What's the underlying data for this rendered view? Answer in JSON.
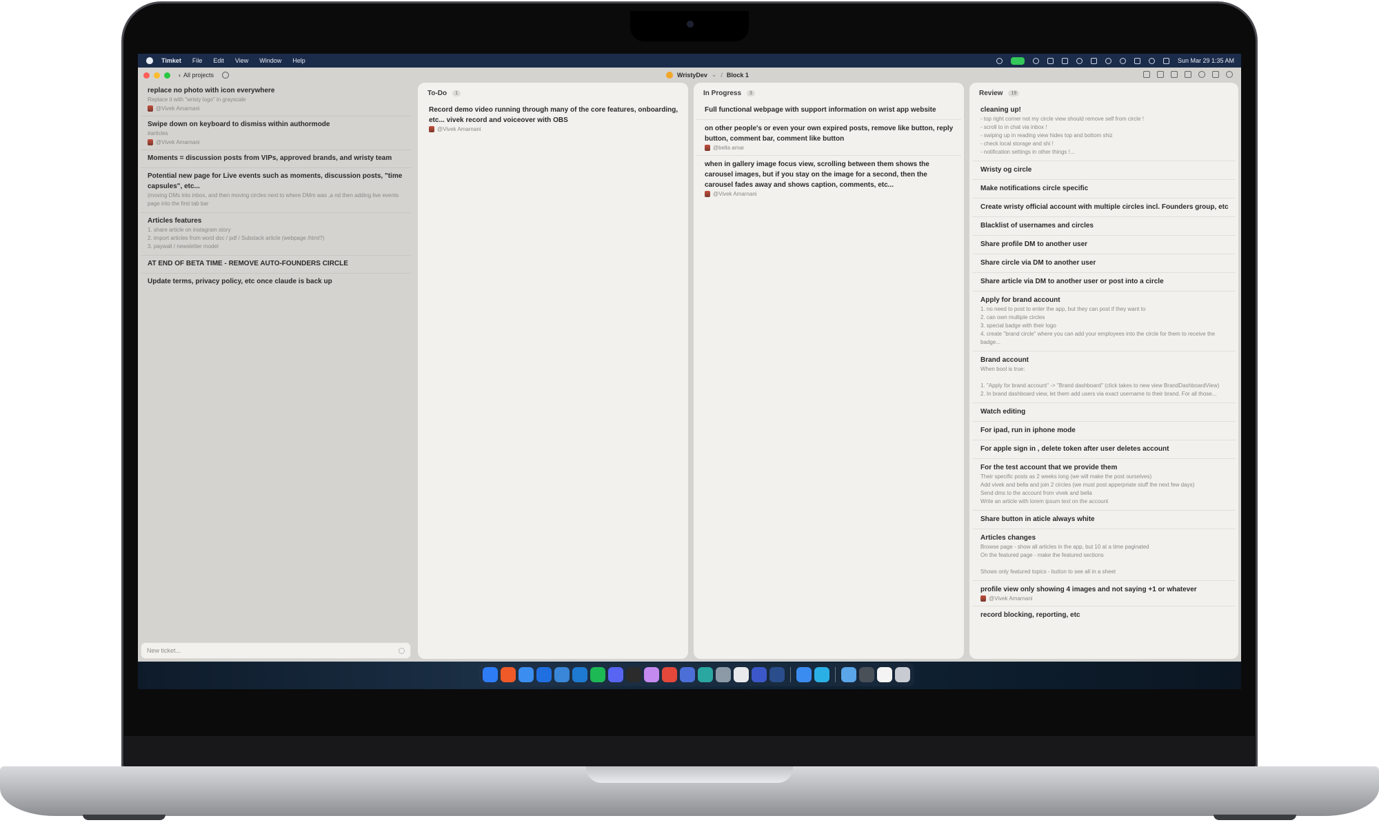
{
  "menubar": {
    "app_name": "Timket",
    "menus": [
      "File",
      "Edit",
      "View",
      "Window",
      "Help"
    ],
    "clock": "Sun Mar 29  1:35 AM"
  },
  "window": {
    "back_label": "All projects",
    "project": "WristyDev",
    "project_caret": "⌄",
    "separator": "/",
    "block": "Block 1"
  },
  "sidebar": {
    "items": [
      {
        "title": "replace no photo with icon everywhere",
        "desc": "Replace it with \"wristy logo\" in grayscale",
        "assignee": "@Vivek Amarnani"
      },
      {
        "title": "Swipe down on keyboard to dismiss within authormode",
        "desc": "#articles",
        "assignee": "@Vivek Amarnani"
      },
      {
        "title": "Moments = discussion posts from VIPs, approved brands, and wristy team",
        "desc": "",
        "assignee": ""
      },
      {
        "title": "Potential new page for Live events such as moments, discussion posts, \"time capsules\", etc...",
        "desc": "(moving DMs into inbox, and then moving circles next to where DMm was ,a nd then adding live events page into the first tab bar",
        "assignee": ""
      },
      {
        "title": "Articles features",
        "desc": "1. share article on instagram story\n2. import articles from word doc / pdf / Substack article (webpage /html?)\n3. paywall / newsletter model",
        "assignee": ""
      },
      {
        "title": "AT END OF BETA TIME - REMOVE AUTO-FOUNDERS CIRCLE",
        "desc": "",
        "assignee": ""
      },
      {
        "title": "Update terms, privacy policy, etc once claude is back up",
        "desc": "",
        "assignee": ""
      }
    ],
    "new_ticket_placeholder": "New ticket..."
  },
  "columns": {
    "todo": {
      "title": "To-Do",
      "count": "1",
      "cards": [
        {
          "title": "Record demo video running through many of the core features, onboarding, etc... vivek record and voiceover with OBS",
          "desc": "",
          "assignee": "@Vivek Amarnani"
        }
      ]
    },
    "progress": {
      "title": "In Progress",
      "count": "3",
      "cards": [
        {
          "title": "Full functional webpage with support information on wrist app website",
          "desc": "",
          "assignee": ""
        },
        {
          "title": "on other people's or even your own expired posts, remove like button, reply button, comment bar, comment like button",
          "desc": "",
          "assignee": "@bella amar"
        },
        {
          "title": "when in gallery image focus view, scrolling between them shows the carousel images, but if you  stay on the image for a second, then the carousel fades away and shows caption, comments, etc...",
          "desc": "",
          "assignee": "@Vivek Amarnani"
        }
      ]
    },
    "review": {
      "title": "Review",
      "count": "19",
      "cards": [
        {
          "title": "cleaning up!",
          "desc": "- top right corner not my circle view should remove self from circle !\n- scroll to in chat via inbox !\n- swiping up in reading view hides top and bottom shiz\n- check local storage and shi !\n- notification settings in other things !...",
          "assignee": ""
        },
        {
          "title": "Wristy og circle",
          "desc": "",
          "assignee": ""
        },
        {
          "title": "Make notifications circle specific",
          "desc": "",
          "assignee": ""
        },
        {
          "title": "Create wristy official account with multiple circles incl. Founders group, etc",
          "desc": "",
          "assignee": ""
        },
        {
          "title": "Blacklist of usernames and circles",
          "desc": "",
          "assignee": ""
        },
        {
          "title": "Share profile DM to another user",
          "desc": "",
          "assignee": ""
        },
        {
          "title": "Share circle via DM to another user",
          "desc": "",
          "assignee": ""
        },
        {
          "title": "Share article via DM to another user or post into a circle",
          "desc": "",
          "assignee": ""
        },
        {
          "title": "Apply for brand account",
          "desc": "1. no need to post to enter the app, but they can post if they want to\n2. can own multiple circles\n3. special badge with their logo\n4. create \"brand circle\" where you can add your employees into the circle for them to receive the badge...",
          "assignee": ""
        },
        {
          "title": "Brand account",
          "desc": "When bool is true:\n\n1. \"Apply for brand account\" -> \"Brand dashboard\" (click takes to new view BrandDashboardView)\n2. In brand dashboard view, let them add users via exact username to their brand. For all those...",
          "assignee": ""
        },
        {
          "title": "Watch editing",
          "desc": "",
          "assignee": ""
        },
        {
          "title": "For ipad, run in iphone mode",
          "desc": "",
          "assignee": ""
        },
        {
          "title": "For apple sign in , delete token after user deletes account",
          "desc": "",
          "assignee": ""
        },
        {
          "title": "For the test account that we provide them",
          "desc": "Their specific posts as 2 weeks long (we will make the post ourselves)\nAdd vivek and bella and join 2 circles (we must post apperpriate stuff the next few days)\nSend dms to the account from vivek and bella\nWrite an article with lorem ipsum text on the account",
          "assignee": ""
        },
        {
          "title": "Share button in aticle always white",
          "desc": "",
          "assignee": ""
        },
        {
          "title": "Articles changes",
          "desc": "Browse page - show all articles in the app, but 10 at a time paginated\nOn the featured page - make the featured sections\n\nShows only featured topics - button to see all in a sheet",
          "assignee": ""
        },
        {
          "title": "profile view only showing 4 images and not saying +1 or whatever",
          "desc": "",
          "assignee": "@Vivek Amarnani"
        },
        {
          "title": "record blocking, reporting, etc",
          "desc": "",
          "assignee": ""
        }
      ]
    }
  },
  "dock": {
    "icons": [
      {
        "name": "finder-icon",
        "color": "#2d7cf6"
      },
      {
        "name": "brave-icon",
        "color": "#f05a28"
      },
      {
        "name": "safari-icon",
        "color": "#3b8df0"
      },
      {
        "name": "xcode-icon",
        "color": "#1f6fe0"
      },
      {
        "name": "simulator-icon",
        "color": "#3a86d8"
      },
      {
        "name": "vscode-icon",
        "color": "#1e7ad0"
      },
      {
        "name": "spotify-icon",
        "color": "#1db954"
      },
      {
        "name": "discord-icon",
        "color": "#5865f2"
      },
      {
        "name": "chatgpt-icon",
        "color": "#2b2b2b"
      },
      {
        "name": "claude-icon",
        "color": "#c58af0"
      },
      {
        "name": "app-red-icon",
        "color": "#e4483a"
      },
      {
        "name": "app-blue-icon",
        "color": "#4b6fd6"
      },
      {
        "name": "app-teal-icon",
        "color": "#2aa7a0"
      },
      {
        "name": "app-gray-icon",
        "color": "#8c9aa8"
      },
      {
        "name": "calendar-icon",
        "color": "#e9e9ec"
      },
      {
        "name": "app-indigo-icon",
        "color": "#3c58c8"
      },
      {
        "name": "app-navy-icon",
        "color": "#2a4d8c"
      },
      {
        "name": "mail-icon",
        "color": "#3b8cf0"
      },
      {
        "name": "app-cyan-icon",
        "color": "#2bb0e6"
      },
      {
        "name": "folder-icon",
        "color": "#5aa6e8"
      },
      {
        "name": "screenshot-icon",
        "color": "#4a5058"
      },
      {
        "name": "document-icon",
        "color": "#f4f4f4"
      },
      {
        "name": "trash-icon",
        "color": "#c8ccd2"
      }
    ]
  }
}
